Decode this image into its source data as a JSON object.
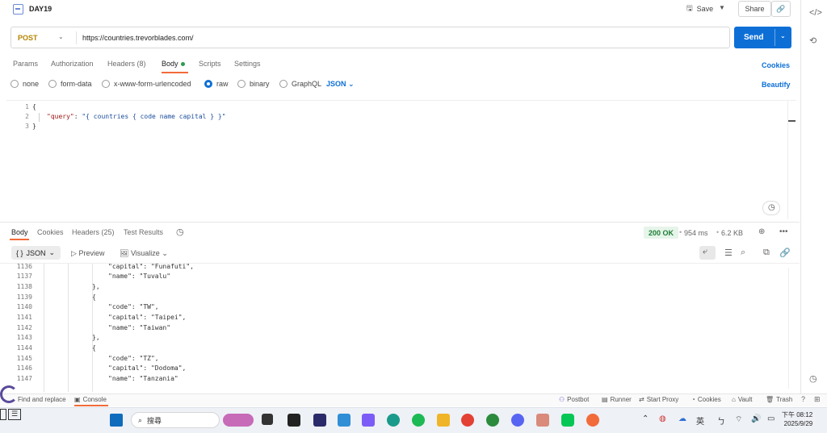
{
  "tab": {
    "title": "DAY19"
  },
  "header": {
    "save_label": "Save",
    "share_label": "Share"
  },
  "request": {
    "method": "POST",
    "url": "https://countries.trevorblades.com/",
    "send_label": "Send",
    "tabs": [
      "Params",
      "Authorization",
      "Headers (8)",
      "Body",
      "Scripts",
      "Settings"
    ],
    "cookies_label": "Cookies",
    "body_types": [
      "none",
      "form-data",
      "x-www-form-urlencoded",
      "raw",
      "binary",
      "GraphQL"
    ],
    "body_format": "JSON",
    "beautify_label": "Beautify"
  },
  "editor": {
    "lines": [
      {
        "num": "1",
        "text": "{"
      },
      {
        "num": "2",
        "key": "\"query\"",
        "value": "\"{ countries { code name capital } }\""
      },
      {
        "num": "3",
        "text": "}"
      }
    ]
  },
  "response": {
    "tabs": [
      "Body",
      "Cookies",
      "Headers (25)",
      "Test Results"
    ],
    "status": "200 OK",
    "time": "954 ms",
    "size": "6.2 KB",
    "format": "JSON",
    "preview_label": "Preview",
    "visualize_label": "Visualize",
    "lines": [
      {
        "num": "1136",
        "text": "\"capital\": \"Funafuti\","
      },
      {
        "num": "1137",
        "text": "\"name\": \"Tuvalu\""
      },
      {
        "num": "1138",
        "text": "},"
      },
      {
        "num": "1139",
        "text": "{"
      },
      {
        "num": "1140",
        "text": "\"code\": \"TW\","
      },
      {
        "num": "1141",
        "text": "\"capital\": \"Taipei\","
      },
      {
        "num": "1142",
        "text": "\"name\": \"Taiwan\""
      },
      {
        "num": "1143",
        "text": "},"
      },
      {
        "num": "1144",
        "text": "{"
      },
      {
        "num": "1145",
        "text": "\"code\": \"TZ\","
      },
      {
        "num": "1146",
        "text": "\"capital\": \"Dodoma\","
      },
      {
        "num": "1147",
        "text": "\"name\": \"Tanzania\""
      }
    ]
  },
  "statusbar": {
    "find_replace": "Find and replace",
    "console": "Console",
    "postbot": "Postbot",
    "runner": "Runner",
    "start_proxy": "Start Proxy",
    "cookies": "Cookies",
    "vault": "Vault",
    "trash": "Trash"
  },
  "taskbar": {
    "search_placeholder": "搜尋",
    "ime": "英",
    "time": "下午 08:12",
    "date": "2025/9/29"
  },
  "colors": {
    "accent": "#0d6fd6",
    "tab_active": "#f26b3a",
    "status_ok": "#1e7e34"
  }
}
